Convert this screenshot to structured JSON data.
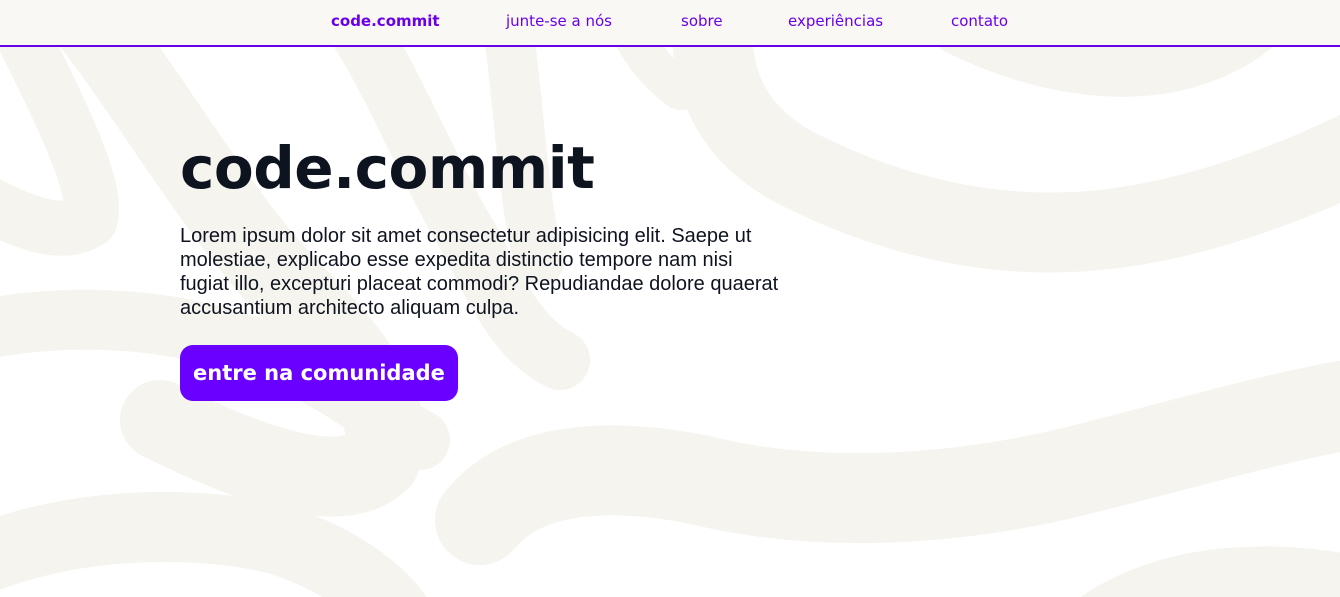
{
  "nav": {
    "brand": "code.commit",
    "items": [
      {
        "label": "junte-se a nós"
      },
      {
        "label": "sobre"
      },
      {
        "label": "experiências"
      },
      {
        "label": "contato"
      }
    ]
  },
  "hero": {
    "title": "code.commit",
    "description": "Lorem ipsum dolor sit amet consectetur adipisicing elit. Saepe ut molestiae, explicabo esse expedita distinctio tempore nam nisi fugiat illo, excepturi placeat commodi? Repudiandae dolore quaerat accusantium architecto aliquam culpa.",
    "cta_label": "entre na comunidade"
  },
  "colors": {
    "accent": "#6a00ff",
    "nav_text": "#6a00e8",
    "text": "#0e1320",
    "nav_background": "#f9f8f5",
    "pattern": "#f6f4ee"
  }
}
